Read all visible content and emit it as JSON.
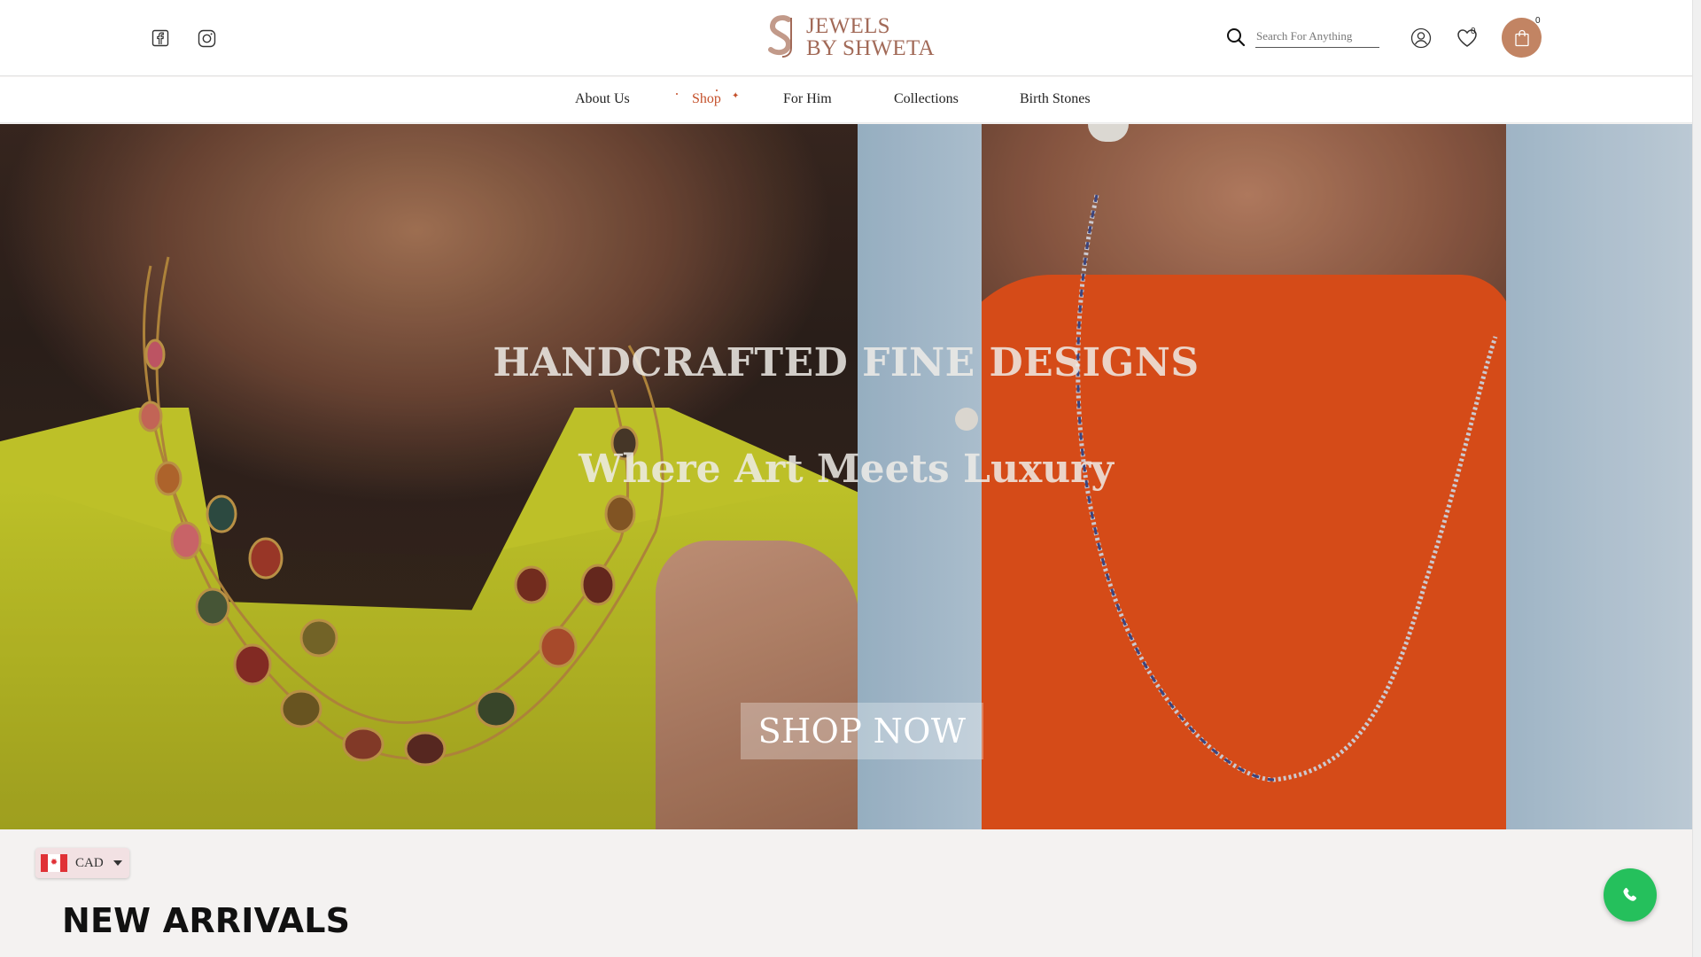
{
  "header": {
    "social": {
      "facebook_icon": "facebook-icon",
      "instagram_icon": "instagram-icon"
    },
    "logo": {
      "line1": "JEWELS",
      "line2": "BY SHWETA",
      "color": "#a26a58"
    },
    "search": {
      "placeholder": "Search For Anything"
    },
    "wishlist_count": "0",
    "cart_count": "0",
    "cart_color": "#c28463"
  },
  "nav": {
    "items": [
      {
        "label": "About Us"
      },
      {
        "label": "Shop"
      },
      {
        "label": "For Him"
      },
      {
        "label": "Collections"
      },
      {
        "label": "Birth Stones"
      }
    ],
    "active_color": "#c4502a"
  },
  "hero": {
    "title": "HANDCRAFTED FINE DESIGNS",
    "subtitle": "Where Art Meets Luxury",
    "cta": "SHOP NOW"
  },
  "currency": {
    "label": "CAD",
    "flag": "canada-flag"
  },
  "section": {
    "title": "NEW ARRIVALS"
  },
  "chat": {
    "icon": "whatsapp-icon",
    "color": "#25c05c"
  }
}
